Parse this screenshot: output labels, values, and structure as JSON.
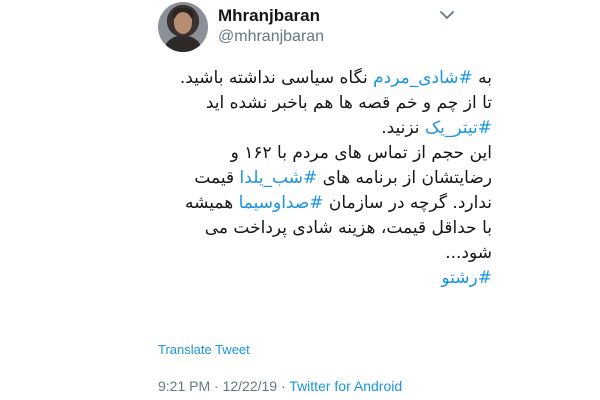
{
  "user": {
    "name": "Mhranjbaran",
    "handle": "@mhranjbaran"
  },
  "icons": {
    "avatar": "user-avatar",
    "menu": "chevron-down-icon"
  },
  "tweet": {
    "l1_a": "به ",
    "l1_tag": "#شادی_مردم",
    "l1_b": " نگاه سیاسی نداشته باشید.",
    "l2": "تا از چم و خم قصه ها هم باخبر نشده اید",
    "l3_tag": "#تیتر_یک",
    "l3_b": " نزنید.",
    "l4": "این حجم از تماس های مردم با ۱۶۲ و",
    "l5_a": "رضایتشان از برنامه های ",
    "l5_tag": "#شب_یلدا",
    "l5_b": " قیمت",
    "l6_a": "ندارد. گرچه در سازمان ",
    "l6_tag": "#صداوسیما",
    "l6_b": " همیشه",
    "l7": "با حداقل قیمت، هزینه شادی پرداخت می",
    "l8": "شود...",
    "l9_tag": "#رشتو"
  },
  "translate_label": "Translate Tweet",
  "meta": {
    "time": "9:21 PM",
    "date": "12/22/19",
    "sep": " · ",
    "source": "Twitter for Android"
  },
  "colors": {
    "link": "#1b95e0",
    "secondary": "#657786",
    "text": "#14171a"
  }
}
